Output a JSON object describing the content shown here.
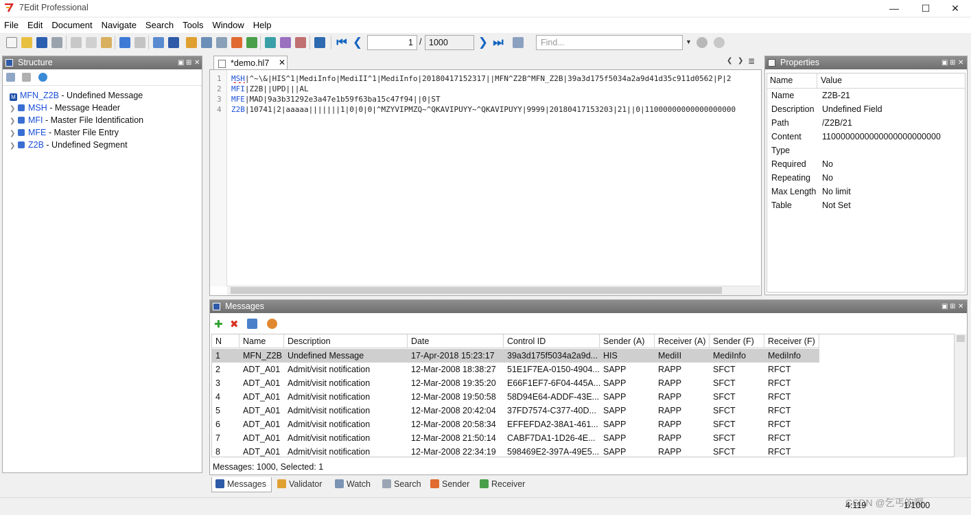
{
  "app": {
    "title": "7Edit Professional"
  },
  "window_controls": [
    "—",
    "☐",
    "✕"
  ],
  "menu": [
    "File",
    "Edit",
    "Document",
    "Navigate",
    "Search",
    "Tools",
    "Window",
    "Help"
  ],
  "toolbar": {
    "page_current": "1",
    "page_sep": "/",
    "page_total": "1000",
    "find_placeholder": "Find..."
  },
  "structure": {
    "title": "Structure",
    "root": {
      "name": "MFN_Z2B",
      "desc": " - Undefined Message"
    },
    "items": [
      {
        "name": "MSH",
        "desc": " - Message Header"
      },
      {
        "name": "MFI",
        "desc": " - Master File Identification"
      },
      {
        "name": "MFE",
        "desc": " - Master File Entry"
      },
      {
        "name": "Z2B",
        "desc": " - Undefined Segment"
      }
    ]
  },
  "editor": {
    "tab_label": "*demo.hl7",
    "lines": [
      {
        "num": "1",
        "seg": "MSH",
        "rest": "|^~\\&|HIS^1|MediInfo|MediII^1|MediInfo|20180417152317||MFN^Z2B^MFN_Z2B|39a3d175f5034a2a9d41d35c911d0562|P|2"
      },
      {
        "num": "2",
        "seg": "MFI",
        "rest": "|Z2B||UPD|||AL"
      },
      {
        "num": "3",
        "seg": "MFE",
        "rest": "|MAD|9a3b31292e3a47e1b59f63ba15c47f94||0|ST"
      },
      {
        "num": "4",
        "seg": "Z2B",
        "rest": "|10741|2|aaaaa|||||||1|0|0|0|^MZYVIPMZQ~^QKAVIPUYY~^QKAVIPUYY|9999|20180417153203|21||0|11000000000000000000"
      }
    ]
  },
  "properties": {
    "title": "Properties",
    "col_name": "Name",
    "col_value": "Value",
    "rows": [
      {
        "k": "Name",
        "v": "Z2B-21"
      },
      {
        "k": "Description",
        "v": "Undefined Field"
      },
      {
        "k": "Path",
        "v": "/Z2B/21"
      },
      {
        "k": "Content",
        "v": "1100000000000000000000000"
      },
      {
        "k": "Type",
        "v": ""
      },
      {
        "k": "Required",
        "v": "No"
      },
      {
        "k": "Repeating",
        "v": "No"
      },
      {
        "k": "Max Length",
        "v": "No limit"
      },
      {
        "k": "Table",
        "v": "Not Set"
      }
    ]
  },
  "messages": {
    "title": "Messages",
    "columns": [
      "N",
      "Name",
      "Description",
      "Date",
      "Control ID",
      "Sender (A)",
      "Receiver (A)",
      "Sender (F)",
      "Receiver (F)"
    ],
    "rows": [
      [
        "1",
        "MFN_Z2B",
        "Undefined Message",
        "17-Apr-2018 15:23:17",
        "39a3d175f5034a2a9d...",
        "HIS",
        "MediII",
        "MediInfo",
        "MediInfo"
      ],
      [
        "2",
        "ADT_A01",
        "Admit/visit notification",
        "12-Mar-2008 18:38:27",
        "51E1F7EA-0150-4904...",
        "SAPP",
        "RAPP",
        "SFCT",
        "RFCT"
      ],
      [
        "3",
        "ADT_A01",
        "Admit/visit notification",
        "12-Mar-2008 19:35:20",
        "E66F1EF7-6F04-445A...",
        "SAPP",
        "RAPP",
        "SFCT",
        "RFCT"
      ],
      [
        "4",
        "ADT_A01",
        "Admit/visit notification",
        "12-Mar-2008 19:50:58",
        "58D94E64-ADDF-43E...",
        "SAPP",
        "RAPP",
        "SFCT",
        "RFCT"
      ],
      [
        "5",
        "ADT_A01",
        "Admit/visit notification",
        "12-Mar-2008 20:42:04",
        "37FD7574-C377-40D...",
        "SAPP",
        "RAPP",
        "SFCT",
        "RFCT"
      ],
      [
        "6",
        "ADT_A01",
        "Admit/visit notification",
        "12-Mar-2008 20:58:34",
        "EFFEFDA2-38A1-461...",
        "SAPP",
        "RAPP",
        "SFCT",
        "RFCT"
      ],
      [
        "7",
        "ADT_A01",
        "Admit/visit notification",
        "12-Mar-2008 21:50:14",
        "CABF7DA1-1D26-4E...",
        "SAPP",
        "RAPP",
        "SFCT",
        "RFCT"
      ],
      [
        "8",
        "ADT_A01",
        "Admit/visit notification",
        "12-Mar-2008 22:34:19",
        "598469E2-397A-49E5...",
        "SAPP",
        "RAPP",
        "SFCT",
        "RFCT"
      ]
    ],
    "status": "Messages: 1000, Selected: 1"
  },
  "bottom_tabs": [
    "Messages",
    "Validator",
    "Watch",
    "Search",
    "Sender",
    "Receiver"
  ],
  "statusbar": {
    "position": "4:119",
    "page": "1/1000",
    "watermark": "CSDN @乞丐的啊"
  },
  "colors": {
    "accent_blue": "#1a4fd8",
    "selected_row": "#cfcfcf",
    "panel_header": "#7a7a7a"
  }
}
